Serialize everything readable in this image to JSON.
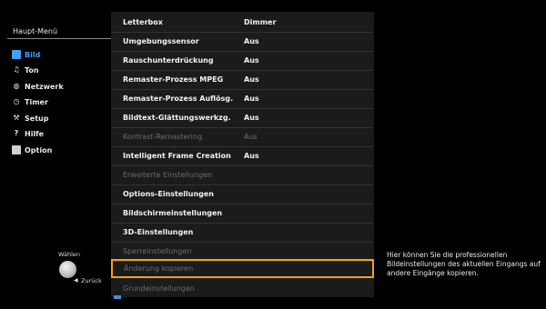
{
  "sidebar": {
    "title": "Haupt-Menü",
    "items": [
      {
        "label": "Bild",
        "icon": "picture-icon",
        "active": true
      },
      {
        "label": "Ton",
        "icon": "music-note-icon"
      },
      {
        "label": "Netzwerk",
        "icon": "globe-icon"
      },
      {
        "label": "Timer",
        "icon": "clock-icon"
      },
      {
        "label": "Setup",
        "icon": "wrench-icon"
      },
      {
        "label": "Hilfe",
        "icon": "question-icon"
      },
      {
        "label": "Option",
        "icon": "option-icon"
      }
    ]
  },
  "settings": {
    "rows": [
      {
        "label": "Letterbox",
        "value": "Dimmer"
      },
      {
        "label": "Umgebungssensor",
        "value": "Aus"
      },
      {
        "label": "Rauschunterdrückung",
        "value": "Aus"
      },
      {
        "label": "Remaster-Prozess MPEG",
        "value": "Aus"
      },
      {
        "label": "Remaster-Prozess Auflösg.",
        "value": "Aus"
      },
      {
        "label": "Bildtext-Glättungswerkzg.",
        "value": "Aus"
      },
      {
        "label": "Kontrast-Remastering",
        "value": "Aus",
        "disabled": true
      },
      {
        "label": "Intelligent Frame Creation",
        "value": "Aus"
      },
      {
        "label": "Erweiterte Einstellungen",
        "value": "",
        "disabled": true
      },
      {
        "label": "Options-Einstellungen",
        "value": ""
      },
      {
        "label": "Bildschirmeinstellungen",
        "value": ""
      },
      {
        "label": "3D-Einstellungen",
        "value": ""
      },
      {
        "label": "Sperreinstellungen",
        "value": "",
        "disabled": true
      },
      {
        "label": "Änderung kopieren",
        "value": "",
        "disabled": true,
        "focused": true
      },
      {
        "label": "Grundeinstellungen",
        "value": "",
        "disabled": true
      }
    ]
  },
  "controls": {
    "select_label": "Wählen",
    "back_label": "Zurück"
  },
  "info": {
    "text": "Hier können Sie die professionellen Bildeinstellungen des aktuellen Eingangs auf andere Eingänge kopieren."
  },
  "colors": {
    "accent_active": "#3fa0ff",
    "focus_border": "#f0a020",
    "panel_bg": "#1b1b1b"
  }
}
